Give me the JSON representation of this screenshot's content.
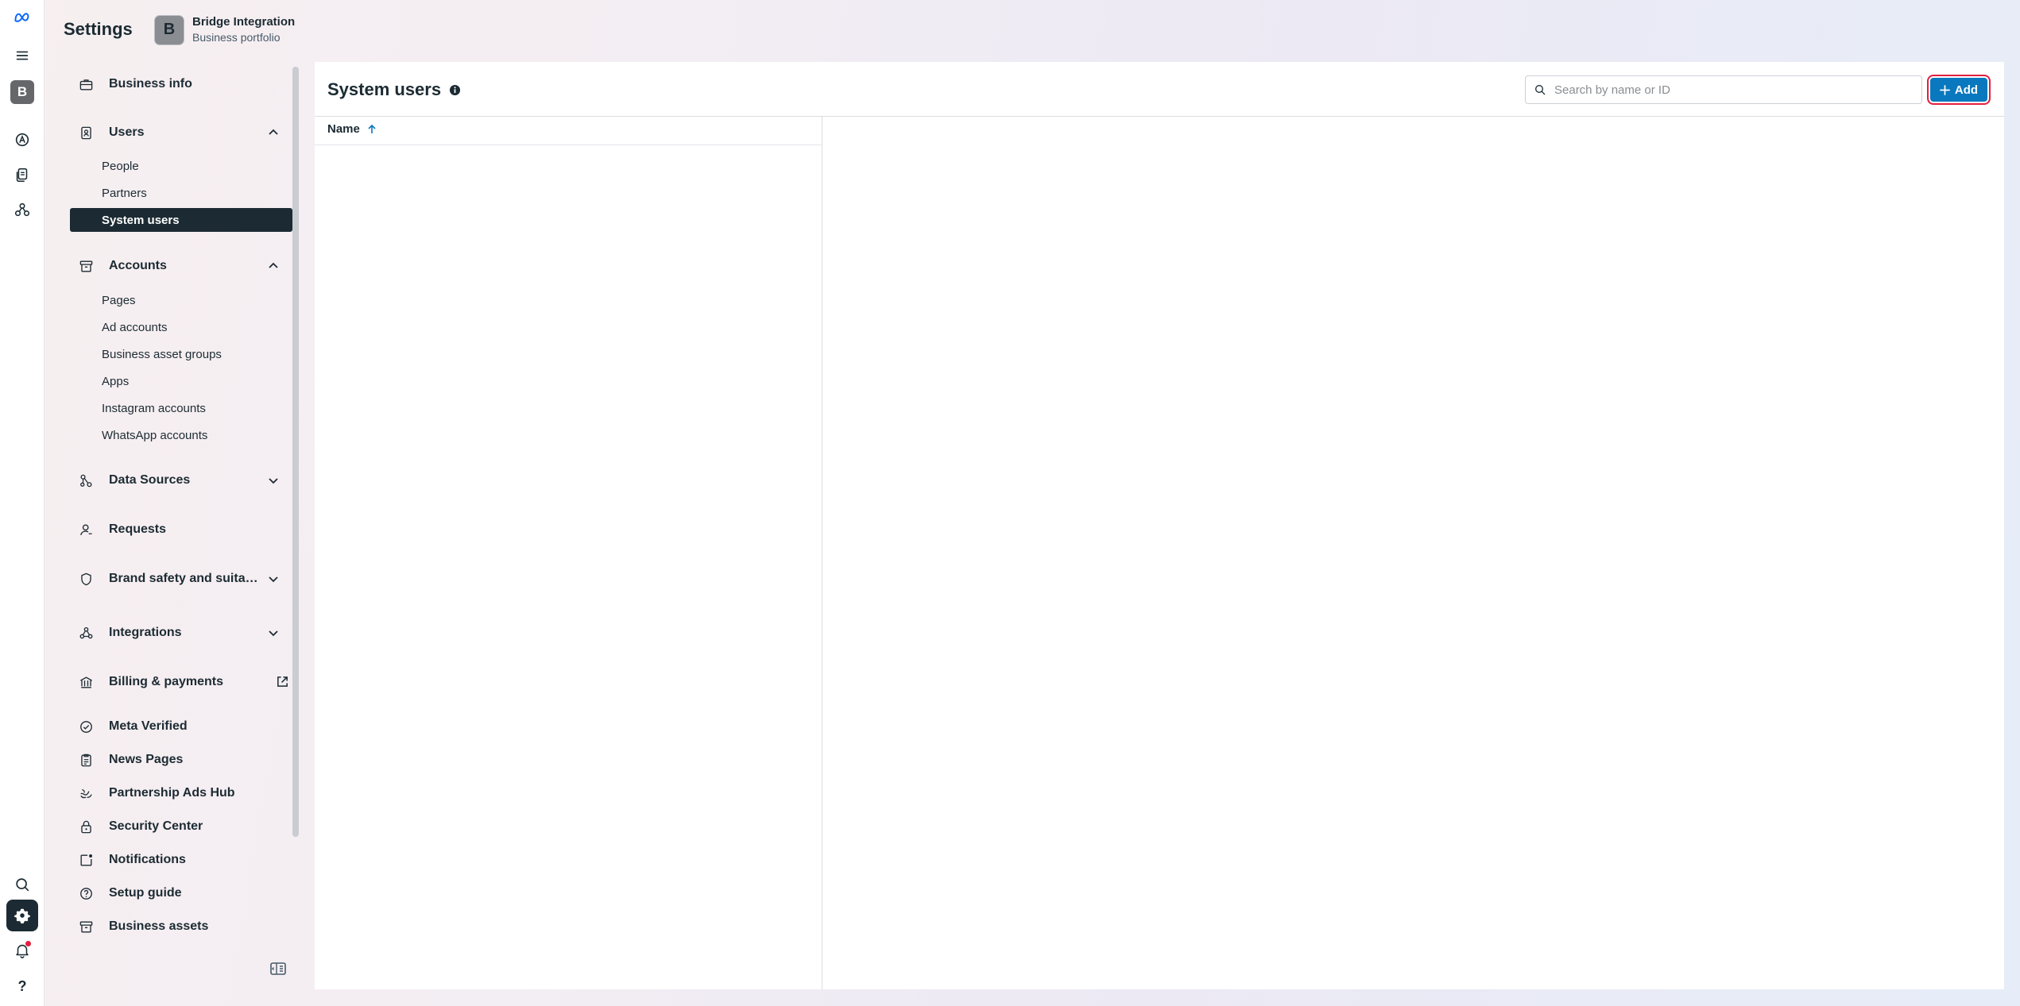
{
  "header": {
    "title": "Settings",
    "portfolio_initial": "B",
    "portfolio_name": "Bridge Integration",
    "portfolio_subtitle": "Business portfolio"
  },
  "rail": {
    "avatar_initial": "B",
    "help_label": "?"
  },
  "sidebar": {
    "business_info": "Business info",
    "users": "Users",
    "users_items": [
      "People",
      "Partners",
      "System users"
    ],
    "accounts": "Accounts",
    "accounts_items": [
      "Pages",
      "Ad accounts",
      "Business asset groups",
      "Apps",
      "Instagram accounts",
      "WhatsApp accounts"
    ],
    "data_sources": "Data Sources",
    "requests": "Requests",
    "brand_safety": "Brand safety and suitabil...",
    "integrations": "Integrations",
    "billing": "Billing & payments",
    "meta_verified": "Meta Verified",
    "news_pages": "News Pages",
    "partnership_ads": "Partnership Ads Hub",
    "security_center": "Security Center",
    "notifications": "Notifications",
    "setup_guide": "Setup guide",
    "business_assets": "Business assets"
  },
  "main": {
    "title": "System users",
    "search_placeholder": "Search by name or ID",
    "add_label": "Add",
    "column_name": "Name"
  },
  "colors": {
    "primary": "#0a78be",
    "highlight": "#e41e3f",
    "active_nav": "#1c2b33"
  }
}
